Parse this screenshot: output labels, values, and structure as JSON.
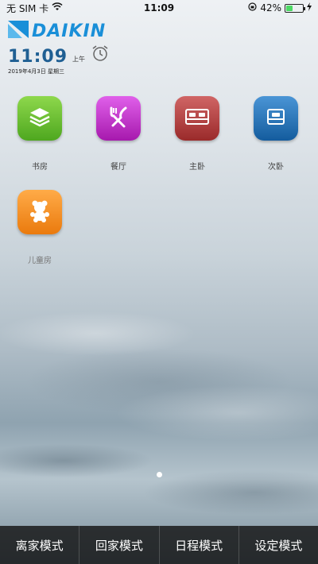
{
  "status_bar": {
    "carrier": "无 SIM 卡",
    "time": "11:09",
    "battery_percent": "42%",
    "battery_level": 0.42
  },
  "brand": {
    "logo_text": "DAIKIN"
  },
  "clock": {
    "time": "11:09",
    "ampm": "上午",
    "date": "2019年4月3日 星期三"
  },
  "rooms": [
    {
      "label": "书房",
      "icon": "layers-icon",
      "color": "#5cb82e"
    },
    {
      "label": "餐厅",
      "icon": "fork-knife-icon",
      "color": "#c22fc9"
    },
    {
      "label": "主卧",
      "icon": "double-bed-icon",
      "color": "#b83c3c"
    },
    {
      "label": "次卧",
      "icon": "single-bed-icon",
      "color": "#1e6fb5"
    },
    {
      "label": "儿童房",
      "icon": "teddy-bear-icon",
      "color": "#f08a1c"
    }
  ],
  "tabs": [
    {
      "label": "离家模式"
    },
    {
      "label": "回家模式"
    },
    {
      "label": "日程模式"
    },
    {
      "label": "设定模式"
    }
  ],
  "pager": {
    "current_page": 1
  }
}
